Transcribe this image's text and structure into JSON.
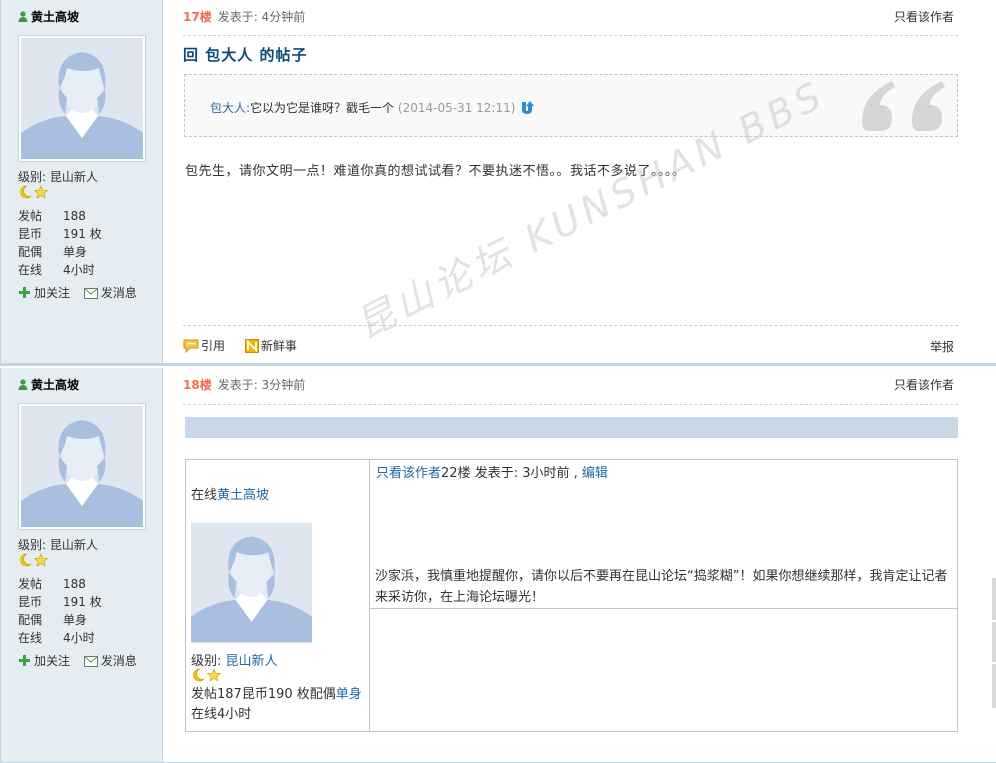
{
  "posts": [
    {
      "author": "黄土高坡",
      "level_label": "级别: 昆山新人",
      "stats": [
        {
          "k": "发帖",
          "v": "188"
        },
        {
          "k": "昆币",
          "v": "191 枚"
        },
        {
          "k": "配偶",
          "v": "单身"
        },
        {
          "k": "在线",
          "v": "4小时"
        }
      ],
      "follow": "加关注",
      "message": "发消息",
      "floor": "17楼",
      "posted": "发表于: 4分钟前",
      "only_author": "只看该作者",
      "title": "回 包大人 的帖子",
      "quote": {
        "name": "包大人:",
        "text": "它以为它是谁呀？戳毛一个",
        "date": "(2014-05-31 12:11)"
      },
      "body": "包先生，请你文明一点！难道你真的想试试看？不要执迷不悟。。我话不多说了。。。。",
      "cite": "引用",
      "fresh": "新鲜事",
      "report": "举报"
    },
    {
      "author": "黄土高坡",
      "level_label": "级别: 昆山新人",
      "stats": [
        {
          "k": "发帖",
          "v": "188"
        },
        {
          "k": "昆币",
          "v": "191 枚"
        },
        {
          "k": "配偶",
          "v": "单身"
        },
        {
          "k": "在线",
          "v": "4小时"
        }
      ],
      "follow": "加关注",
      "message": "发消息",
      "floor": "18楼",
      "posted": "发表于: 3分钟前",
      "only_author": "只看该作者",
      "inner": {
        "online_prefix": "在线",
        "online_name": "黄土高坡",
        "level_prefix": "级别: ",
        "level_value": "昆山新人",
        "stat_text": "发帖187昆币190 枚配偶",
        "stat_link": "单身",
        "stat_suffix": "在线4小时",
        "head_link": "只看该作者",
        "head_text": "22楼 发表于: 3小时前 , ",
        "head_edit": "编辑",
        "body": "沙家浜，我慎重地提醒你，请你以后不要再在昆山论坛“捣浆糊”！如果你想继续那样，我肯定让记者来采访你，在上海论坛曝光！"
      }
    }
  ],
  "watermark": "昆山论坛 KUNSHAN BBS",
  "colors": {
    "floor": "#f26c4f",
    "sidebar": "#e5edf2",
    "title": "#0c4a7a",
    "link": "#1f6aa5",
    "bluebar": "#c8d8e8"
  }
}
